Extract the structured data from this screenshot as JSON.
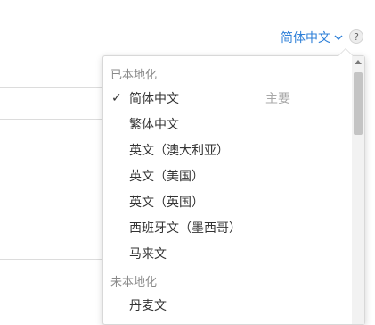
{
  "language_switch": {
    "label": "简体中文",
    "chevron_icon": "chevron-down-icon"
  },
  "help": {
    "label": "?"
  },
  "dropdown": {
    "group_localized": "已本地化",
    "group_unlocalized": "未本地化",
    "items": [
      {
        "label": "简体中文",
        "selected": true,
        "tag": "主要"
      },
      {
        "label": "繁体中文"
      },
      {
        "label": "英文（澳大利亚）"
      },
      {
        "label": "英文（美国）"
      },
      {
        "label": "英文（英国）"
      },
      {
        "label": "西班牙文（墨西哥）"
      },
      {
        "label": "马来文"
      }
    ],
    "unlocalized_items": [
      {
        "label": "丹麦文"
      }
    ],
    "check_glyph": "✓"
  },
  "colors": {
    "accent": "#2f80d8"
  }
}
